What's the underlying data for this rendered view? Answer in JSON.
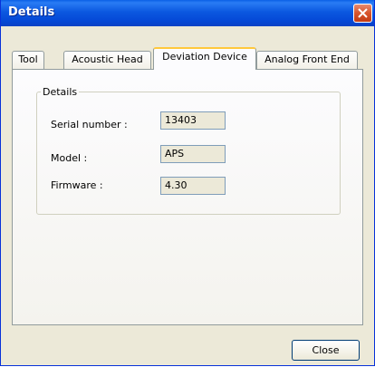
{
  "window": {
    "title": "Details",
    "close_icon": "close-icon"
  },
  "tabs": [
    {
      "label": "Tool",
      "active": false
    },
    {
      "label": "Acoustic Head",
      "active": false
    },
    {
      "label": "Deviation Device",
      "active": true
    },
    {
      "label": "Analog Front End",
      "active": false
    }
  ],
  "details_group": {
    "title": "Details",
    "fields": [
      {
        "label": "Serial number :",
        "value": "13403"
      },
      {
        "label": "Model :",
        "value": "APS"
      },
      {
        "label": "Firmware :",
        "value": "4.30"
      }
    ]
  },
  "footer": {
    "close_label": "Close"
  },
  "colors": {
    "titlebar": "#0b58e0",
    "close_button": "#d8552c",
    "dialog_bg": "#ece9d8"
  }
}
